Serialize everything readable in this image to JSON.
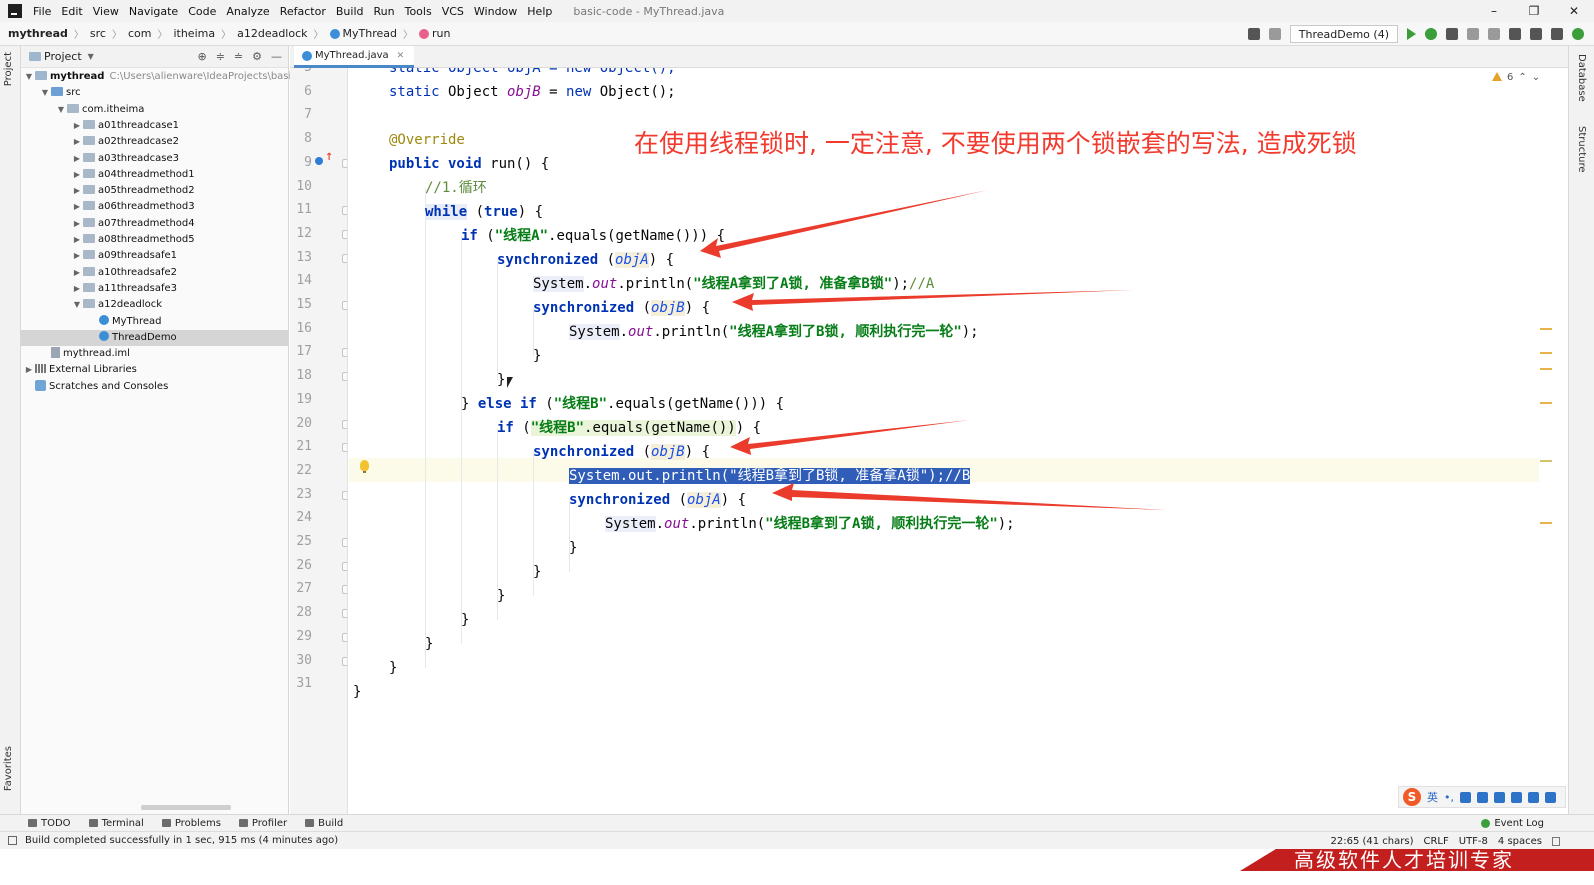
{
  "menu": {
    "items": [
      "File",
      "Edit",
      "View",
      "Navigate",
      "Code",
      "Analyze",
      "Refactor",
      "Build",
      "Run",
      "Tools",
      "VCS",
      "Window",
      "Help"
    ],
    "window_title": "basic-code - MyThread.java"
  },
  "breadcrumbs": {
    "items": [
      "mythread",
      "src",
      "com",
      "itheima",
      "a12deadlock",
      "MyThread",
      "run"
    ]
  },
  "toolbar": {
    "run_config": "ThreadDemo (4)"
  },
  "project_panel": {
    "title": "Project",
    "tree": [
      {
        "label": "mythread",
        "extra": "C:\\Users\\alienware\\IdeaProjects\\basic",
        "depth": 0,
        "arrow": "open"
      },
      {
        "label": "src",
        "depth": 1,
        "arrow": "open"
      },
      {
        "label": "com.itheima",
        "depth": 2,
        "arrow": "open"
      },
      {
        "label": "a01threadcase1",
        "depth": 3,
        "arrow": "closed"
      },
      {
        "label": "a02threadcase2",
        "depth": 3,
        "arrow": "closed"
      },
      {
        "label": "a03threadcase3",
        "depth": 3,
        "arrow": "closed"
      },
      {
        "label": "a04threadmethod1",
        "depth": 3,
        "arrow": "closed"
      },
      {
        "label": "a05threadmethod2",
        "depth": 3,
        "arrow": "closed"
      },
      {
        "label": "a06threadmethod3",
        "depth": 3,
        "arrow": "closed"
      },
      {
        "label": "a07threadmethod4",
        "depth": 3,
        "arrow": "closed"
      },
      {
        "label": "a08threadmethod5",
        "depth": 3,
        "arrow": "closed"
      },
      {
        "label": "a09threadsafe1",
        "depth": 3,
        "arrow": "closed"
      },
      {
        "label": "a10threadsafe2",
        "depth": 3,
        "arrow": "closed"
      },
      {
        "label": "a11threadsafe3",
        "depth": 3,
        "arrow": "closed"
      },
      {
        "label": "a12deadlock",
        "depth": 3,
        "arrow": "open"
      },
      {
        "label": "MyThread",
        "depth": 4,
        "arrow": "none",
        "kind": "class"
      },
      {
        "label": "ThreadDemo",
        "depth": 4,
        "arrow": "none",
        "kind": "class",
        "selected": true
      },
      {
        "label": "mythread.iml",
        "depth": 1,
        "arrow": "none",
        "kind": "iml"
      },
      {
        "label": "External Libraries",
        "depth": 0,
        "arrow": "closed",
        "kind": "lib"
      },
      {
        "label": "Scratches and Consoles",
        "depth": 0,
        "arrow": "none",
        "kind": "scratch"
      }
    ]
  },
  "side_labels": {
    "left_top": "Project",
    "left_bottom": "Favorites",
    "right_top": "Database",
    "right_mid": "Structure"
  },
  "editor": {
    "tab": "MyThread.java",
    "warnings": "6",
    "line_numbers": [
      "5",
      "6",
      "7",
      "8",
      "9",
      "10",
      "11",
      "12",
      "13",
      "14",
      "15",
      "16",
      "17",
      "18",
      "19",
      "20",
      "21",
      "22",
      "23",
      "24",
      "25",
      "26",
      "27",
      "28",
      "29",
      "30",
      "31"
    ],
    "lines": {
      "l5": "static Object objA = new Object();",
      "l6_kw": "static",
      "l6_type": " Object ",
      "l6_var": "objB",
      "l6_eq": " = ",
      "l6_new": "new",
      "l6_end": " Object();",
      "l8": "@Override",
      "l9_a": "public void",
      "l9_b": " run() {",
      "l10": "//1.循环",
      "l11_kw": "while",
      "l11_b": " (",
      "l11_true": "true",
      "l11_c": ") {",
      "l12_kw": "if",
      "l12_b": " (",
      "l12_str": "\"线程A\"",
      "l12_c": ".equals(getName())) {",
      "l13_kw": "synchronized",
      "l13_b": " (",
      "l13_var": "objA",
      "l13_c": ") {",
      "l14_sys": "System",
      "l14_b": ".",
      "l14_out": "out",
      "l14_c": ".println(",
      "l14_str": "\"线程A拿到了A锁, 准备拿B锁\"",
      "l14_d": ");",
      "l14_cmt": "//A",
      "l15_kw": "synchronized",
      "l15_b": " (",
      "l15_var": "objB",
      "l15_c": ") {",
      "l16_sys": "System",
      "l16_b": ".",
      "l16_out": "out",
      "l16_c": ".println(",
      "l16_str": "\"线程A拿到了B锁, 顺利执行完一轮\"",
      "l16_d": ");",
      "l17": "}",
      "l18": "}",
      "l19_a": "} ",
      "l19_else": "else if",
      "l19_b": " (",
      "l19_str": "\"线程B\"",
      "l19_c": ".equals(getName())) {",
      "l20_kw": "if",
      "l20_b": " (",
      "l20_str": "\"线程B\"",
      "l20_c": ".equals(getName())",
      "l20_d": ") {",
      "l21_kw": "synchronized",
      "l21_b": " (",
      "l21_var": "objB",
      "l21_c": ") {",
      "l22_sel": "System.out.println(\"线程B拿到了B锁, 准备拿A锁\");//B",
      "l23_kw": "synchronized",
      "l23_b": " (",
      "l23_var": "objA",
      "l23_c": ") {",
      "l24_sys": "System",
      "l24_b": ".",
      "l24_out": "out",
      "l24_c": ".println(",
      "l24_str": "\"线程B拿到了A锁, 顺利执行完一轮\"",
      "l24_d": ");",
      "l25": "}",
      "l26": "}",
      "l27": "}",
      "l28": "}",
      "l29": "}",
      "l30": "}",
      "l31": "}"
    }
  },
  "annotation": {
    "note": "在使用线程锁时, 一定注意, 不要使用两个锁嵌套的写法, 造成死锁"
  },
  "ime": {
    "logo": "S",
    "lang": "英",
    "punct": "•,"
  },
  "tool_tabs": [
    "TODO",
    "Terminal",
    "Problems",
    "Profiler",
    "Build"
  ],
  "event_log": "Event Log",
  "status": {
    "message": "Build completed successfully in 1 sec, 915 ms (4 minutes ago)",
    "position": "22:65 (41 chars)",
    "line_sep": "CRLF",
    "encoding": "UTF-8",
    "indent": "4 spaces"
  },
  "banner": {
    "text": "高级软件人才培训专家"
  },
  "colors": {
    "keyword": "#0033b3",
    "string": "#067d17",
    "annotation_red": "#f23a2e",
    "selection": "#2f5db8",
    "banner": "#c41f1f"
  }
}
